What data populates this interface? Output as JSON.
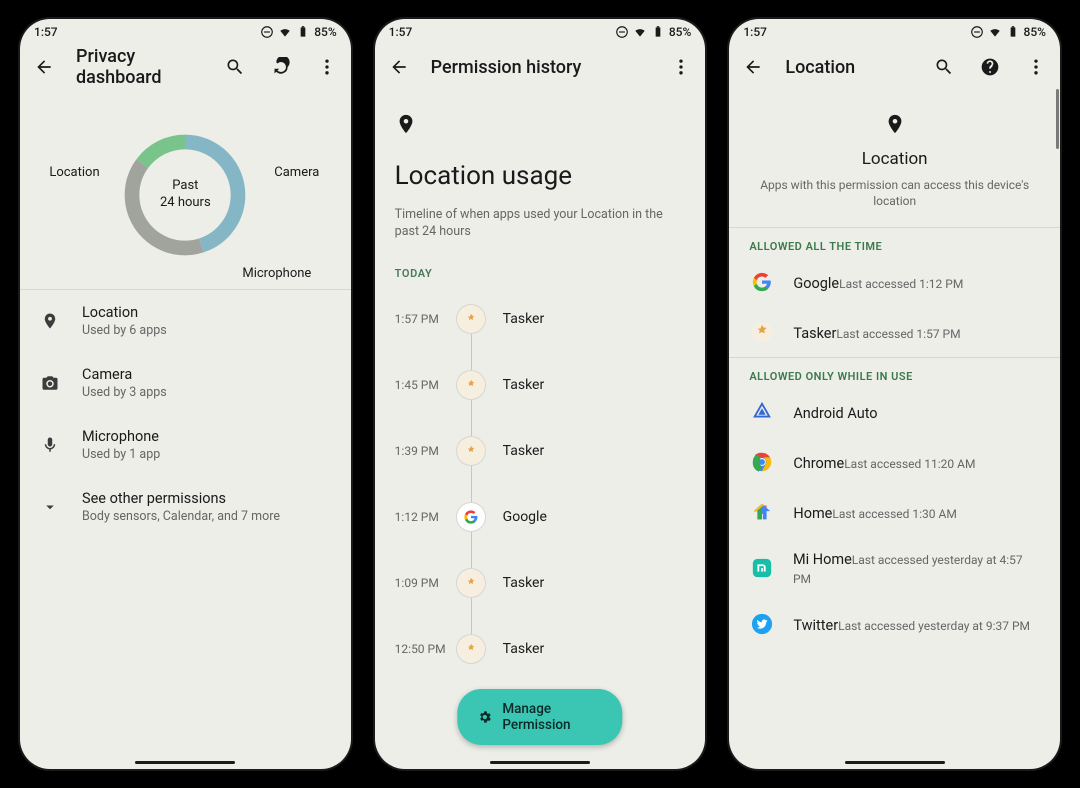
{
  "status": {
    "time": "1:57",
    "battery": "85%"
  },
  "screen1": {
    "title": "Privacy dashboard",
    "donut": {
      "center_l1": "Past",
      "center_l2": "24 hours",
      "label_loc": "Location",
      "label_cam": "Camera",
      "label_mic": "Microphone"
    },
    "rows": [
      {
        "t": "Location",
        "s": "Used by 6 apps"
      },
      {
        "t": "Camera",
        "s": "Used by 3 apps"
      },
      {
        "t": "Microphone",
        "s": "Used by 1 app"
      },
      {
        "t": "See other permissions",
        "s": "Body sensors, Calendar, and 7 more"
      }
    ]
  },
  "screen2": {
    "title": "Permission history",
    "heading": "Location usage",
    "sub": "Timeline of when apps used your Location in the past 24 hours",
    "section": "TODAY",
    "items": [
      {
        "time": "1:57 PM",
        "app": "Tasker",
        "icon": "tasker"
      },
      {
        "time": "1:45 PM",
        "app": "Tasker",
        "icon": "tasker"
      },
      {
        "time": "1:39 PM",
        "app": "Tasker",
        "icon": "tasker"
      },
      {
        "time": "1:12 PM",
        "app": "Google",
        "icon": "google"
      },
      {
        "time": "1:09 PM",
        "app": "Tasker",
        "icon": "tasker"
      },
      {
        "time": "12:50 PM",
        "app": "Tasker",
        "icon": "tasker"
      }
    ],
    "manage": "Manage Permission"
  },
  "screen3": {
    "title": "Location",
    "heading": "Location",
    "sub": "Apps with this permission can access this device's location",
    "sect_all": "ALLOWED ALL THE TIME",
    "all": [
      {
        "t": "Google",
        "s": "Last accessed 1:12 PM",
        "icon": "google"
      },
      {
        "t": "Tasker",
        "s": "Last accessed 1:57 PM",
        "icon": "tasker"
      }
    ],
    "sect_use": "ALLOWED ONLY WHILE IN USE",
    "use": [
      {
        "t": "Android Auto",
        "s": "",
        "icon": "auto"
      },
      {
        "t": "Chrome",
        "s": "Last accessed 11:20 AM",
        "icon": "chrome"
      },
      {
        "t": "Home",
        "s": "Last accessed 1:30 AM",
        "icon": "ghome"
      },
      {
        "t": "Mi Home",
        "s": "Last accessed yesterday at 4:57 PM",
        "icon": "mihome"
      },
      {
        "t": "Twitter",
        "s": "Last accessed yesterday at 9:37 PM",
        "icon": "twitter"
      }
    ]
  },
  "chart_data": {
    "type": "pie",
    "title": "Past 24 hours",
    "series": [
      {
        "name": "Location",
        "value": 45,
        "color": "#85b6c5"
      },
      {
        "name": "Camera",
        "value": 40,
        "color": "#a0a49c"
      },
      {
        "name": "Microphone",
        "value": 15,
        "color": "#79c48a"
      }
    ]
  }
}
